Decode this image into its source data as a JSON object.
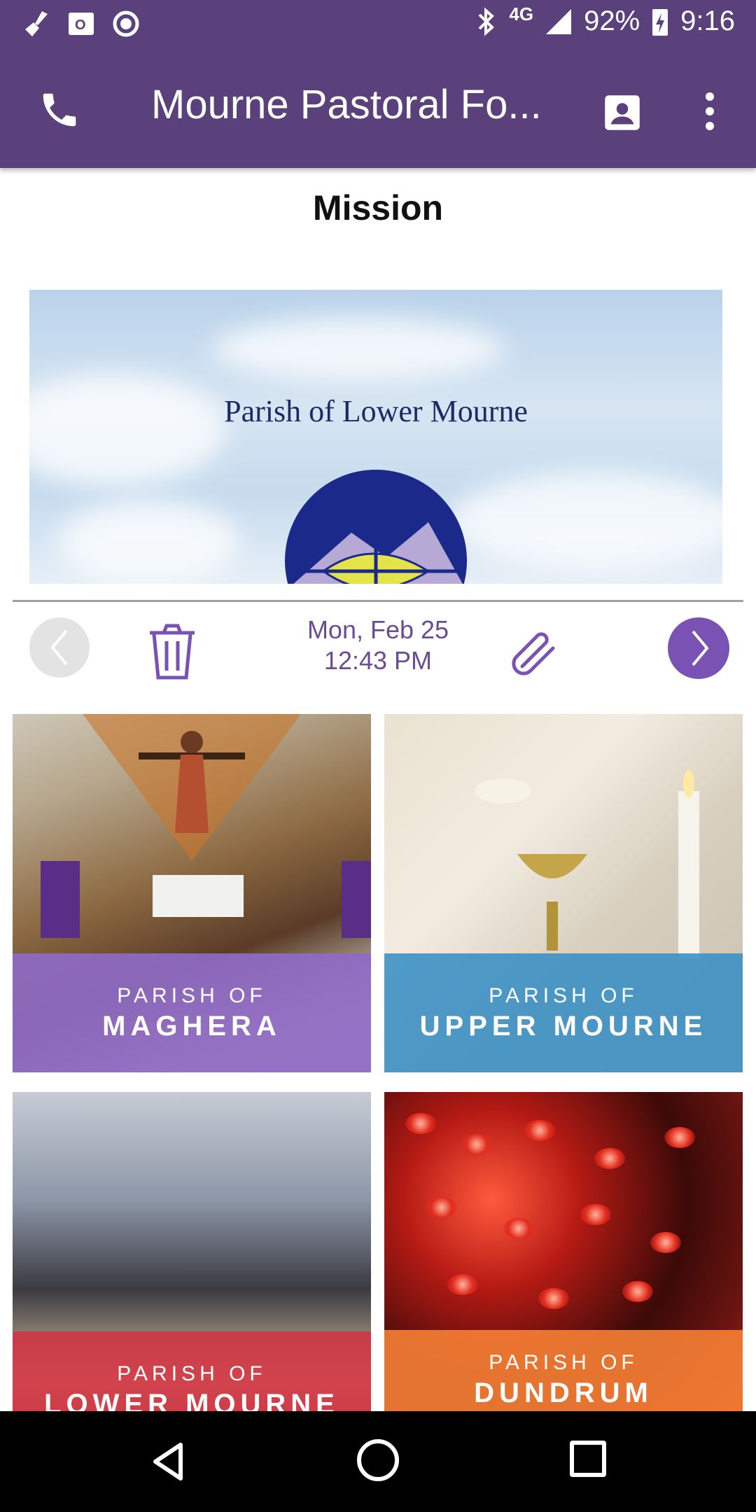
{
  "status": {
    "network": "4G",
    "battery": "92%",
    "time": "9:16"
  },
  "appbar": {
    "title": "Mourne Pastoral Fo..."
  },
  "page": {
    "title": "Mission"
  },
  "banner": {
    "text": "Parish of Lower Mourne"
  },
  "post": {
    "date": "Mon, Feb 25",
    "time": "12:43 PM"
  },
  "tiles": [
    {
      "small": "PARISH OF",
      "big": "MAGHERA"
    },
    {
      "small": "PARISH OF",
      "big": "UPPER MOURNE"
    },
    {
      "small": "PARISH OF",
      "big": "LOWER MOURNE"
    },
    {
      "small": "PARISH OF",
      "big": "DUNDRUM"
    }
  ],
  "colors": {
    "primary": "#5b417b",
    "accent": "#7a52b3"
  }
}
